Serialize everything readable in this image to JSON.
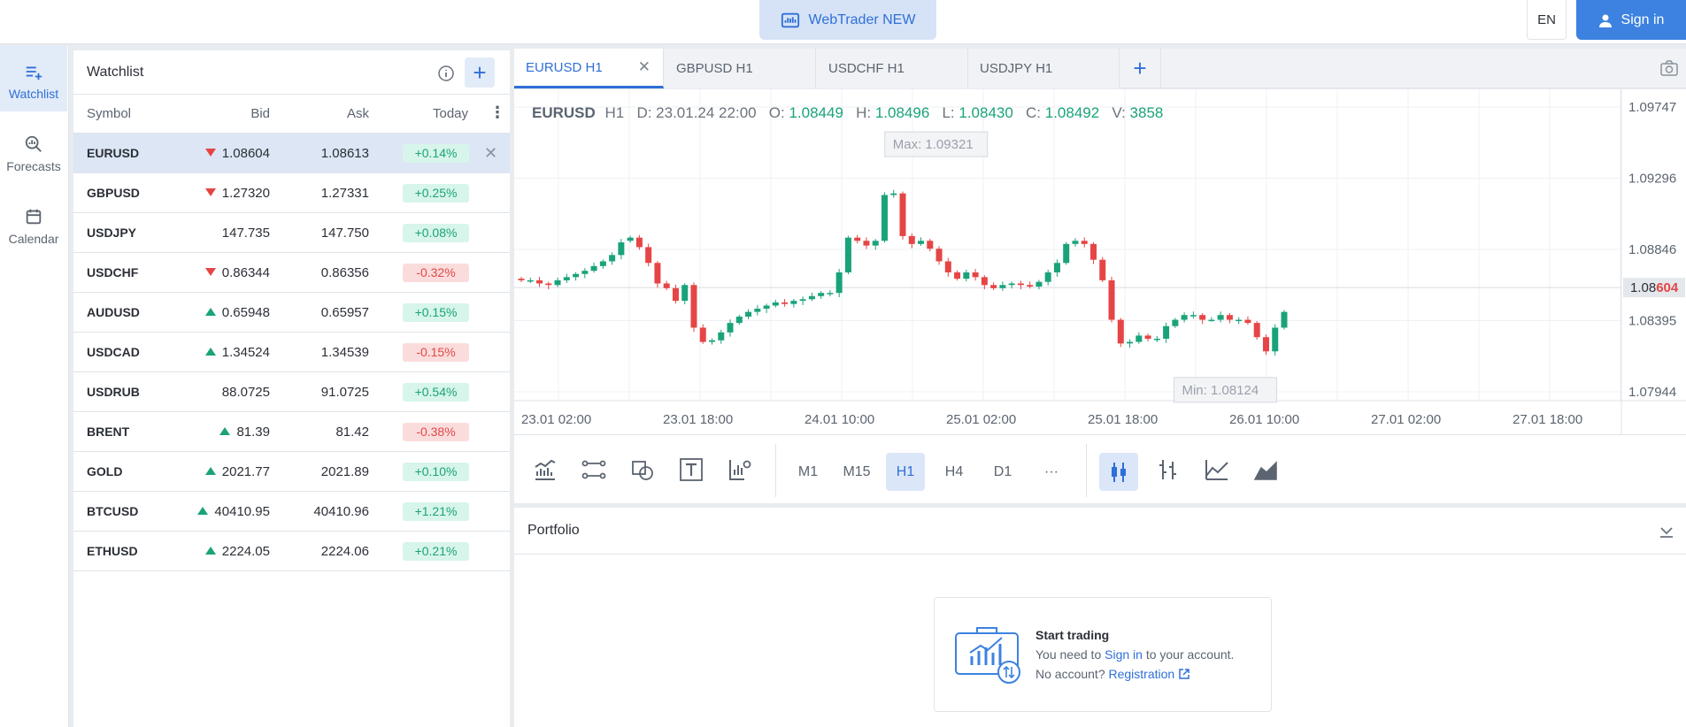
{
  "header": {
    "webtrader_label": "WebTrader NEW",
    "lang": "EN",
    "signin_label": "Sign in"
  },
  "nav": [
    {
      "label": "Watchlist",
      "icon": "watchlist-icon",
      "active": true
    },
    {
      "label": "Forecasts",
      "icon": "search-chart-icon",
      "active": false
    },
    {
      "label": "Calendar",
      "icon": "calendar-icon",
      "active": false
    }
  ],
  "watchlist": {
    "title": "Watchlist",
    "columns": {
      "symbol": "Symbol",
      "bid": "Bid",
      "ask": "Ask",
      "today": "Today"
    },
    "rows": [
      {
        "symbol": "EURUSD",
        "dir": "down",
        "bid": "1.08604",
        "ask": "1.08613",
        "today": "+0.14%",
        "sign": "pos"
      },
      {
        "symbol": "GBPUSD",
        "dir": "down",
        "bid": "1.27320",
        "ask": "1.27331",
        "today": "+0.25%",
        "sign": "pos"
      },
      {
        "symbol": "USDJPY",
        "dir": "",
        "bid": "147.735",
        "ask": "147.750",
        "today": "+0.08%",
        "sign": "pos"
      },
      {
        "symbol": "USDCHF",
        "dir": "down",
        "bid": "0.86344",
        "ask": "0.86356",
        "today": "-0.32%",
        "sign": "neg"
      },
      {
        "symbol": "AUDUSD",
        "dir": "up",
        "bid": "0.65948",
        "ask": "0.65957",
        "today": "+0.15%",
        "sign": "pos"
      },
      {
        "symbol": "USDCAD",
        "dir": "up",
        "bid": "1.34524",
        "ask": "1.34539",
        "today": "-0.15%",
        "sign": "neg"
      },
      {
        "symbol": "USDRUB",
        "dir": "",
        "bid": "88.0725",
        "ask": "91.0725",
        "today": "+0.54%",
        "sign": "pos"
      },
      {
        "symbol": "BRENT",
        "dir": "up",
        "bid": "81.39",
        "ask": "81.42",
        "today": "-0.38%",
        "sign": "neg"
      },
      {
        "symbol": "GOLD",
        "dir": "up",
        "bid": "2021.77",
        "ask": "2021.89",
        "today": "+0.10%",
        "sign": "pos"
      },
      {
        "symbol": "BTCUSD",
        "dir": "up",
        "bid": "40410.95",
        "ask": "40410.96",
        "today": "+1.21%",
        "sign": "pos"
      },
      {
        "symbol": "ETHUSD",
        "dir": "up",
        "bid": "2224.05",
        "ask": "2224.06",
        "today": "+0.21%",
        "sign": "pos"
      }
    ]
  },
  "tabs": [
    {
      "label": "EURUSD H1",
      "active": true
    },
    {
      "label": "GBPUSD H1",
      "active": false
    },
    {
      "label": "USDCHF H1",
      "active": false
    },
    {
      "label": "USDJPY H1",
      "active": false
    }
  ],
  "ohlc": {
    "symbol": "EURUSD",
    "tf": "H1",
    "date": "D: 23.01.24 22:00",
    "o_label": "O:",
    "o": "1.08449",
    "h_label": "H:",
    "h": "1.08496",
    "l_label": "L:",
    "l": "1.08430",
    "c_label": "C:",
    "c": "1.08492",
    "v_label": "V:",
    "v": "3858"
  },
  "chart_data": {
    "type": "candlestick",
    "y_ticks": [
      "1.09747",
      "1.09296",
      "1.08846",
      "1.08395",
      "1.07944"
    ],
    "x_ticks": [
      "23.01 02:00",
      "23.01 18:00",
      "24.01 10:00",
      "25.01 02:00",
      "25.01 18:00",
      "26.01 10:00",
      "27.01 02:00",
      "27.01 18:00"
    ],
    "ylim": [
      1.07944,
      1.09747
    ],
    "current_price_prefix": "1.08",
    "current_price_suffix": "604",
    "current_price": 1.08604,
    "max_label": "Max: 1.09321",
    "min_label": "Min: 1.08124",
    "max_value": 1.09321,
    "min_value": 1.08124,
    "closes": [
      1.0865,
      1.0865,
      1.0863,
      1.0862,
      1.0865,
      1.0867,
      1.0869,
      1.0871,
      1.0874,
      1.0877,
      1.0881,
      1.0889,
      1.0892,
      1.0886,
      1.0876,
      1.0863,
      1.086,
      1.0852,
      1.0862,
      1.0835,
      1.0826,
      1.0827,
      1.0832,
      1.0838,
      1.0842,
      1.0845,
      1.0847,
      1.0849,
      1.0851,
      1.085,
      1.0852,
      1.0853,
      1.0855,
      1.0857,
      1.0857,
      1.087,
      1.0892,
      1.089,
      1.0887,
      1.089,
      1.0919,
      1.092,
      1.0893,
      1.0888,
      1.089,
      1.0885,
      1.0877,
      1.087,
      1.0866,
      1.087,
      1.0867,
      1.0862,
      1.086,
      1.0862,
      1.0863,
      1.0862,
      1.0861,
      1.0864,
      1.087,
      1.0876,
      1.0888,
      1.089,
      1.0888,
      1.0878,
      1.0865,
      1.084,
      1.0825,
      1.0826,
      1.083,
      1.0828,
      1.0828,
      1.0836,
      1.084,
      1.0843,
      1.0843,
      1.084,
      1.084,
      1.0843,
      1.084,
      1.084,
      1.0838,
      1.0829,
      1.082,
      1.0835,
      1.0845
    ],
    "opens": [
      1.0866,
      1.0865,
      1.0865,
      1.0863,
      1.0862,
      1.0865,
      1.0867,
      1.0869,
      1.0871,
      1.0874,
      1.0877,
      1.0881,
      1.089,
      1.0892,
      1.0886,
      1.0876,
      1.0863,
      1.086,
      1.0852,
      1.0862,
      1.0835,
      1.0826,
      1.0827,
      1.0832,
      1.0838,
      1.0842,
      1.0845,
      1.0847,
      1.0849,
      1.0851,
      1.085,
      1.0852,
      1.0853,
      1.0855,
      1.0857,
      1.0857,
      1.087,
      1.0892,
      1.089,
      1.0887,
      1.089,
      1.0919,
      1.092,
      1.0893,
      1.0888,
      1.089,
      1.0885,
      1.0877,
      1.087,
      1.0866,
      1.087,
      1.0867,
      1.0862,
      1.086,
      1.0862,
      1.0863,
      1.0862,
      1.0861,
      1.0864,
      1.087,
      1.0876,
      1.0888,
      1.089,
      1.0888,
      1.0878,
      1.0865,
      1.084,
      1.0825,
      1.0826,
      1.083,
      1.0828,
      1.0828,
      1.0836,
      1.084,
      1.0843,
      1.0843,
      1.084,
      1.084,
      1.0843,
      1.084,
      1.084,
      1.0838,
      1.0829,
      1.082,
      1.0835
    ]
  },
  "toolbar": {
    "draw_tools": [
      "indicators-icon",
      "line-tool-icon",
      "shapes-icon",
      "text-tool-icon",
      "settings-chart-icon"
    ],
    "timeframes": [
      "M1",
      "M15",
      "H1",
      "H4",
      "D1",
      "···"
    ],
    "active_tf": "H1",
    "chart_types": [
      "candles-icon",
      "bars-icon",
      "line-chart-icon",
      "area-chart-icon"
    ]
  },
  "portfolio": {
    "title": "Portfolio",
    "card_title": "Start trading",
    "line1_pre": "You need to ",
    "line1_link": "Sign in",
    "line1_post": " to your account.",
    "line2_pre": "No account? ",
    "line2_link": "Registration"
  },
  "colors": {
    "accent": "#2f6fd8",
    "up": "#1aa37a",
    "down": "#e64545"
  }
}
